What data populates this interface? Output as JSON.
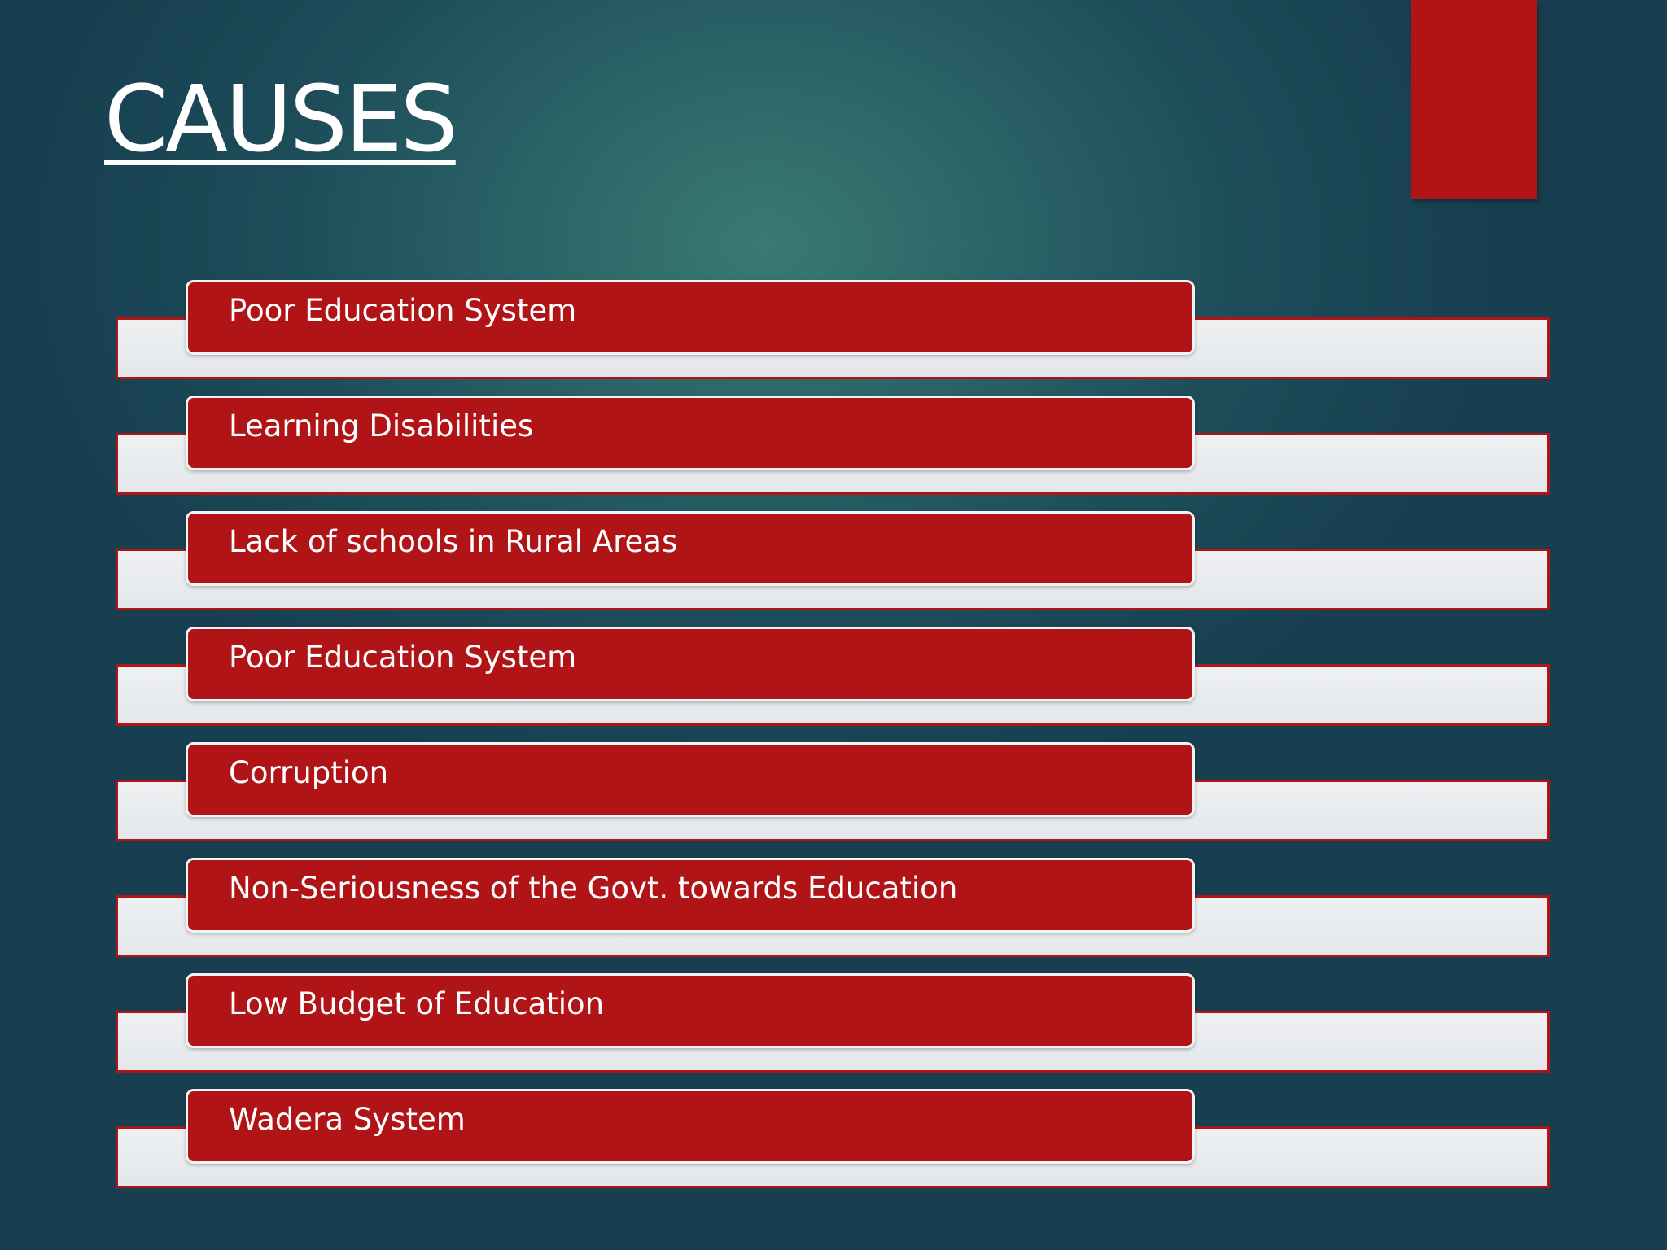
{
  "slide": {
    "title": "CAUSES",
    "colors": {
      "background": "#1e4d5a",
      "accent_red": "#b01417",
      "band_light": "#eceef0",
      "text": "#ffffff"
    },
    "items": [
      {
        "label": "Poor Education System"
      },
      {
        "label": "Learning Disabilities"
      },
      {
        "label": "Lack of schools in Rural Areas"
      },
      {
        "label": "Poor Education System"
      },
      {
        "label": "Corruption"
      },
      {
        "label": "Non-Seriousness of the Govt. towards Education"
      },
      {
        "label": "Low Budget of Education"
      },
      {
        "label": "Wadera System"
      }
    ]
  }
}
